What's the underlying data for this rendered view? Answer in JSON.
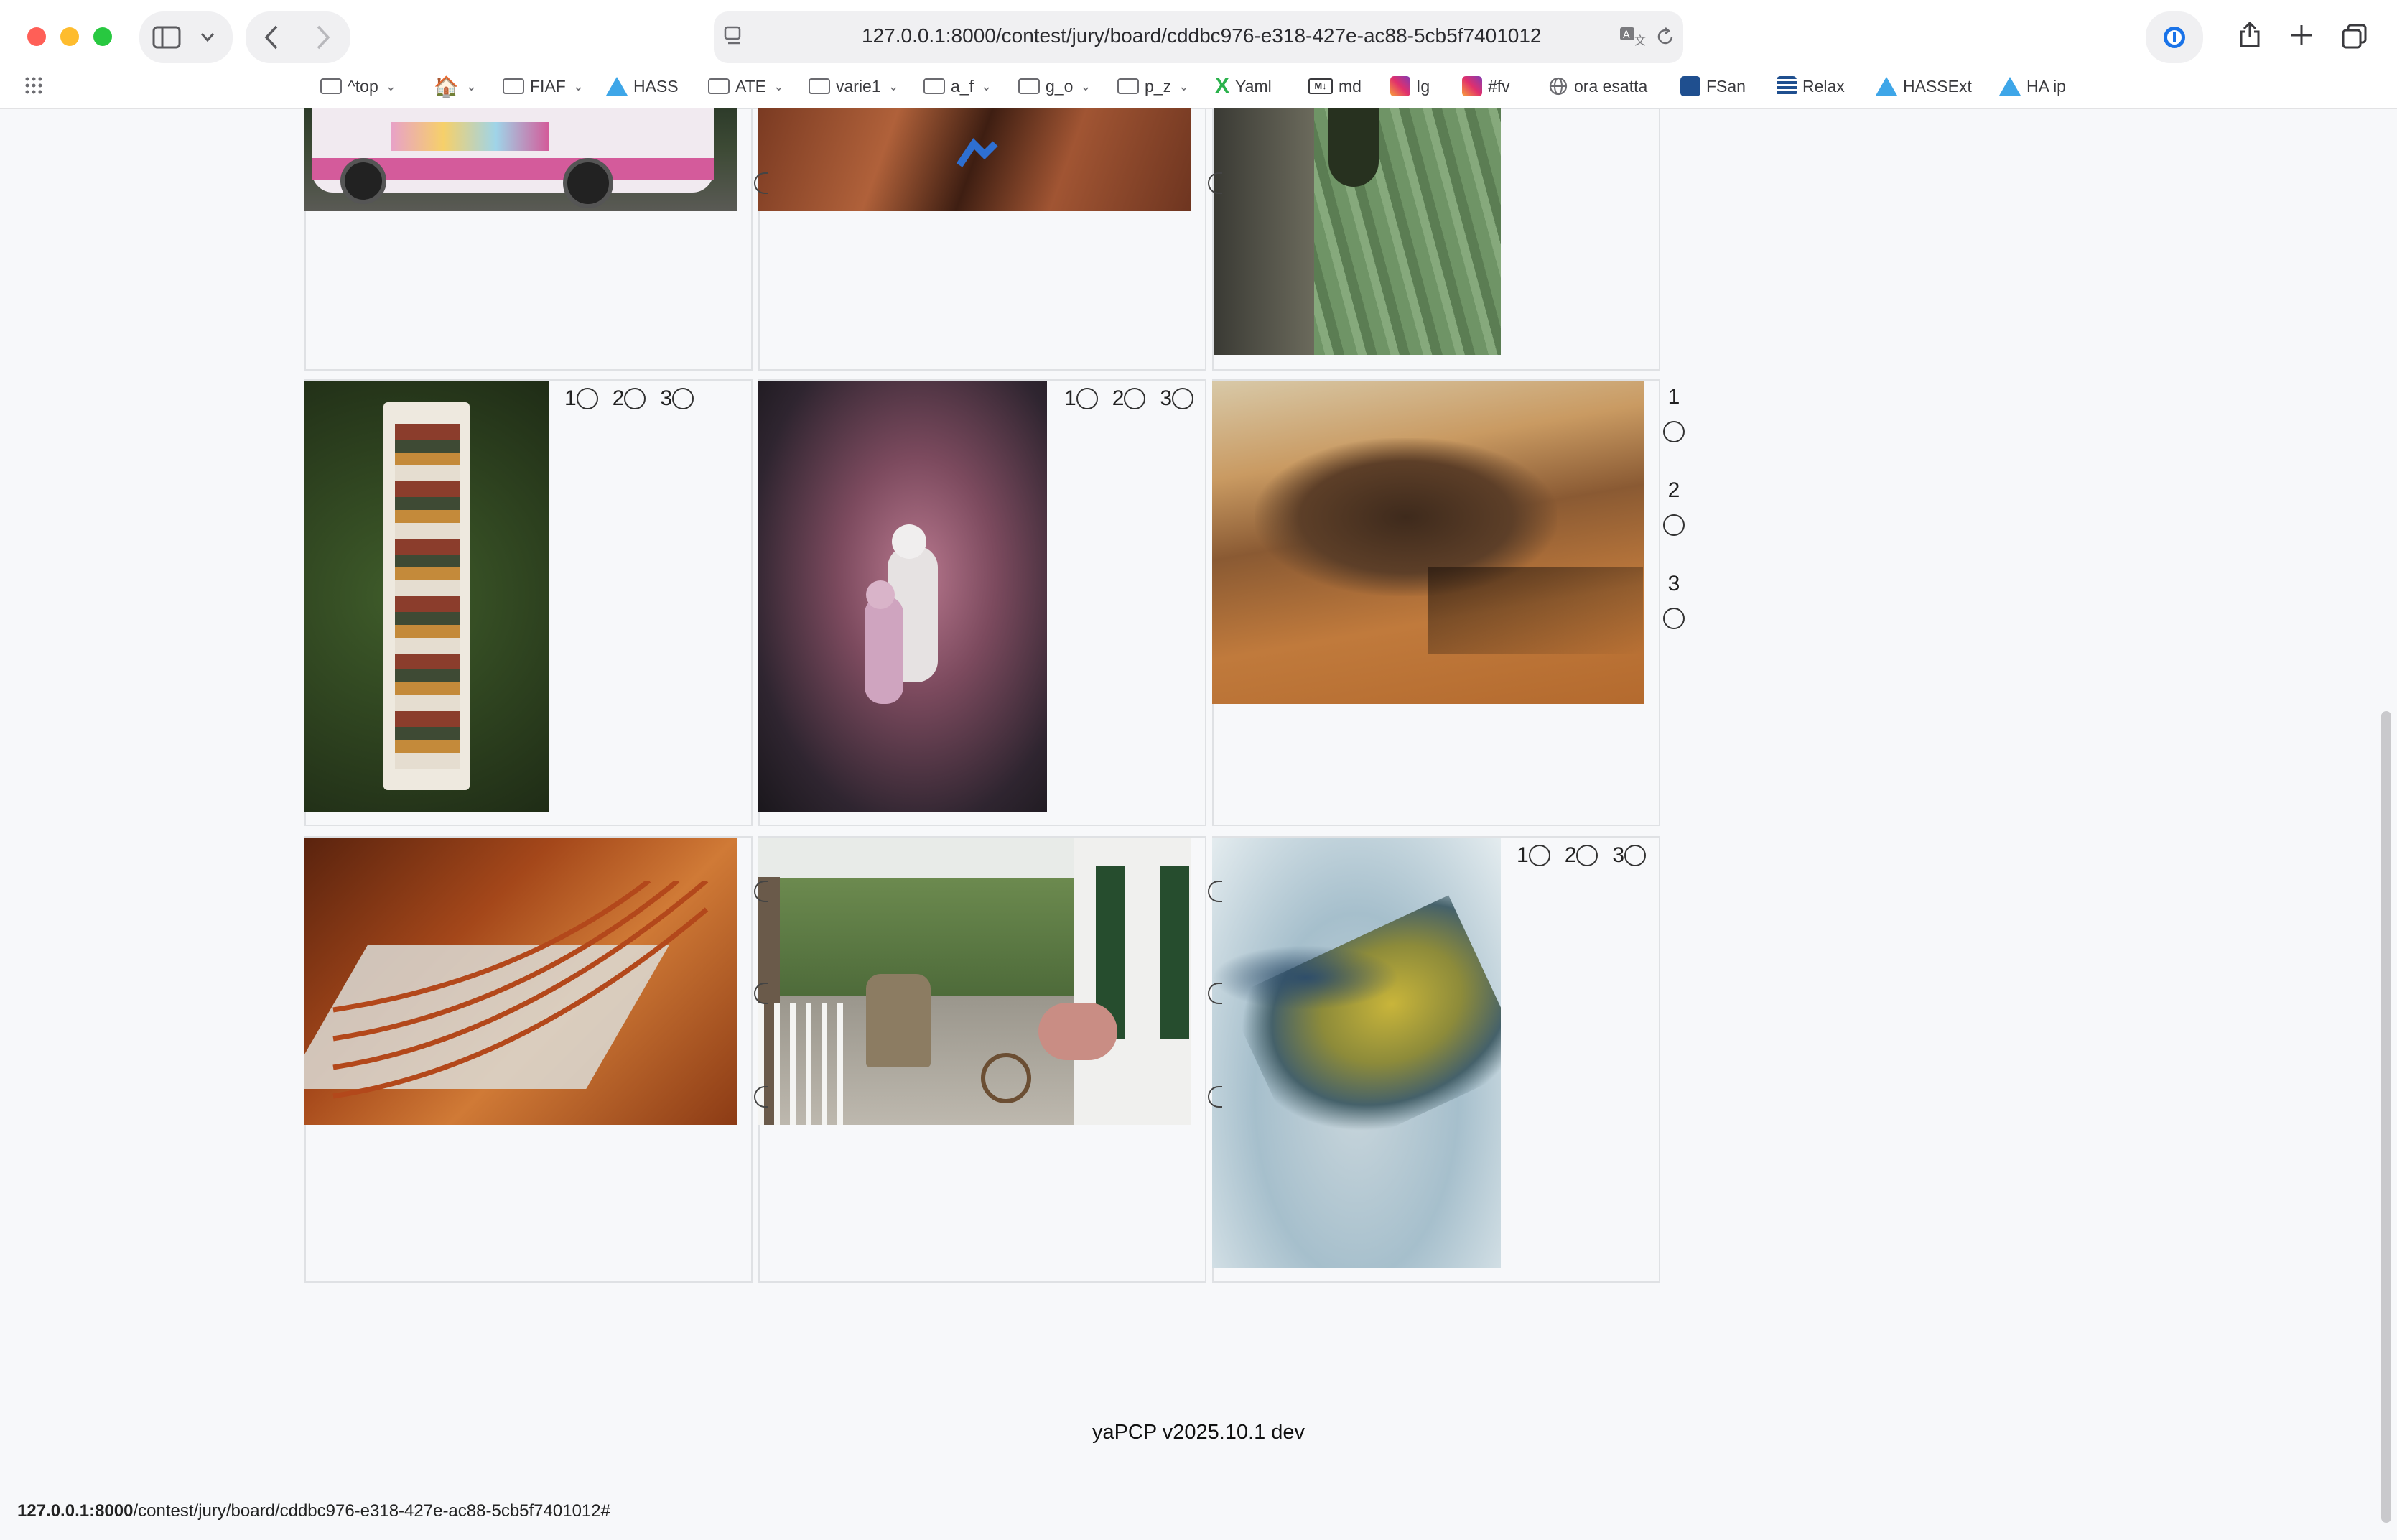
{
  "browser": {
    "url": "127.0.0.1:8000/contest/jury/board/cddbc976-e318-427e-ac88-5cb5f7401012",
    "bookmarks": [
      {
        "label": "^top",
        "icon": "folder-icon",
        "menu": true
      },
      {
        "label": "",
        "icon": "home-icon",
        "menu": true
      },
      {
        "label": "FIAF",
        "icon": "folder-icon",
        "menu": true
      },
      {
        "label": "HASS",
        "icon": "home-assistant-icon",
        "menu": false
      },
      {
        "label": "ATE",
        "icon": "folder-icon",
        "menu": true
      },
      {
        "label": "varie1",
        "icon": "folder-icon",
        "menu": true
      },
      {
        "label": "a_f",
        "icon": "folder-icon",
        "menu": true
      },
      {
        "label": "g_o",
        "icon": "folder-icon",
        "menu": true
      },
      {
        "label": "p_z",
        "icon": "folder-icon",
        "menu": true
      },
      {
        "label": "Yaml",
        "icon": "yaml-icon",
        "menu": false
      },
      {
        "label": "md",
        "icon": "markdown-icon",
        "menu": false
      },
      {
        "label": "Ig",
        "icon": "instagram-icon",
        "menu": false
      },
      {
        "label": "#fv",
        "icon": "instagram-icon",
        "menu": false
      },
      {
        "label": "ora esatta",
        "icon": "globe-icon",
        "menu": false
      },
      {
        "label": "FSan",
        "icon": "fsan-icon",
        "menu": false
      },
      {
        "label": "Relax",
        "icon": "relax-icon",
        "menu": false
      },
      {
        "label": "HASSExt",
        "icon": "home-assistant-icon",
        "menu": false
      },
      {
        "label": "HA ip",
        "icon": "home-assistant-icon",
        "menu": false
      }
    ]
  },
  "ranking": {
    "r1": "1",
    "r2": "2",
    "r3": "3"
  },
  "footer": {
    "version": "yaPCP v2025.10.1 dev"
  },
  "status_bar": {
    "host": "127.0.0.1:8000",
    "path": "/contest/jury/board/cddbc976-e318-427e-ac88-5cb5f7401012#"
  },
  "colors": {
    "accent": "#3ea6e8",
    "traffic_red": "#ff5f57",
    "traffic_yellow": "#febc2e",
    "traffic_green": "#28c840"
  }
}
